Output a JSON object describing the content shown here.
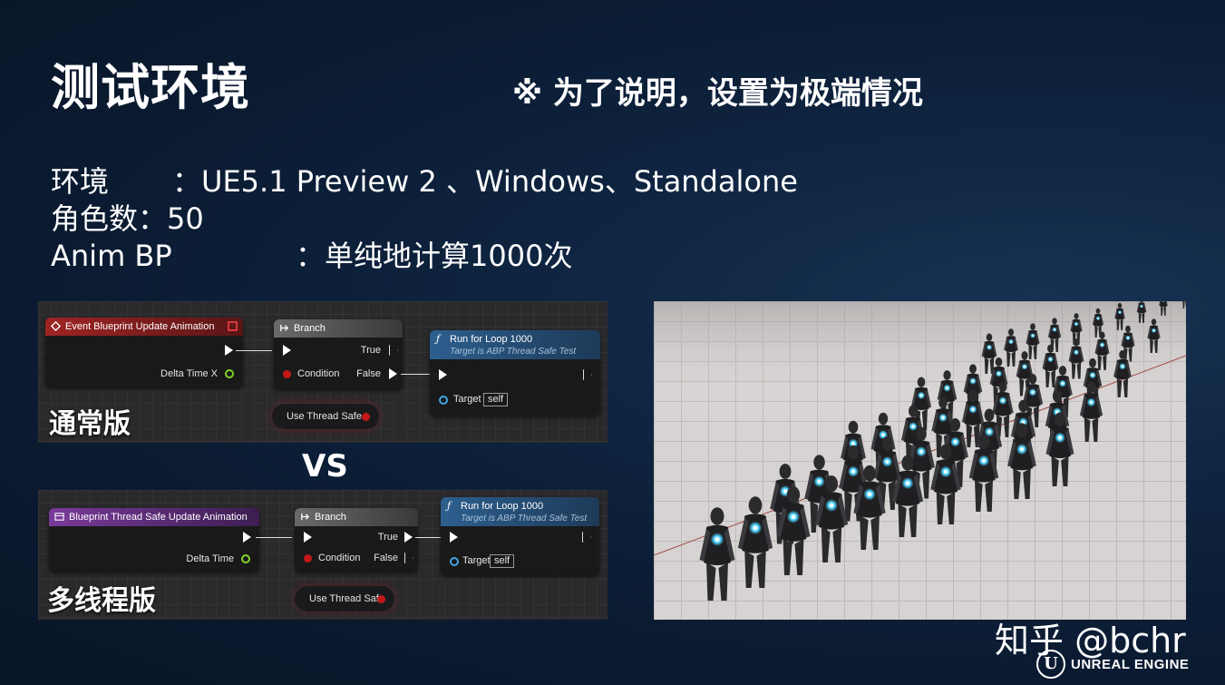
{
  "title": "测试环境",
  "note": "※ 为了说明，设置为极端情况",
  "info": [
    {
      "key": "环境",
      "sep": "：",
      "value": "UE5.1 Preview 2 、Windows、Standalone"
    },
    {
      "key": "角色数",
      "sep": "：",
      "value": "50"
    },
    {
      "key": "Anim BP",
      "sep": "：",
      "value": "单纯地计算1000次"
    }
  ],
  "normal": {
    "caption": "通常版",
    "event_title": "Event Blueprint Update Animation",
    "delta_label": "Delta Time X",
    "branch_title": "Branch",
    "true_label": "True",
    "false_label": "False",
    "condition_label": "Condition",
    "loop_title": "Run for Loop 1000",
    "loop_sub": "Target is ABP Thread Safe Test",
    "target_label": "Target",
    "target_value": "self",
    "pill_label": "Use Thread Safe"
  },
  "vs": "VS",
  "threaded": {
    "caption": "多线程版",
    "event_title": "Blueprint Thread Safe Update Animation",
    "delta_label": "Delta Time",
    "branch_title": "Branch",
    "true_label": "True",
    "false_label": "False",
    "condition_label": "Condition",
    "loop_title": "Run for Loop 1000",
    "loop_sub": "Target is ABP Thread Safe Test",
    "target_label": "Target",
    "target_value": "self",
    "pill_label": "Use Thread Safe"
  },
  "watermark": "知乎 @bchr",
  "logo_text": "UNREAL ENGINE",
  "logo_glyph": "U",
  "colors": {
    "event_red": "#a02424",
    "event_purple": "#7a3a9a",
    "float_green": "#7ed321",
    "bool_red": "#c21818",
    "object_blue": "#3fa7e0",
    "mannequin_glow": "#4fd3ff"
  }
}
